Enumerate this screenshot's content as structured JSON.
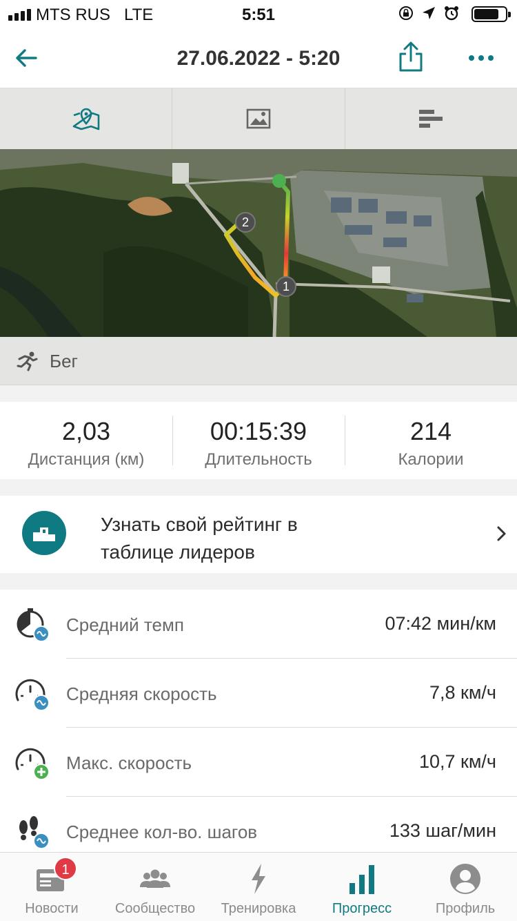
{
  "status_bar": {
    "carrier": "MTS RUS",
    "network": "LTE",
    "time": "5:51",
    "icons": [
      "orientation-lock-icon",
      "location-arrow-icon",
      "alarm-icon",
      "battery-icon"
    ],
    "battery_level": 0.8
  },
  "header": {
    "title": "27.06.2022 - 5:20",
    "back_icon": "back-arrow-icon",
    "share_icon": "share-icon",
    "more_icon": "more-dots-icon"
  },
  "segment_tabs": [
    {
      "name": "map",
      "icon": "map-pin-icon",
      "active": true
    },
    {
      "name": "photos",
      "icon": "image-icon",
      "active": false
    },
    {
      "name": "stats",
      "icon": "bars-icon",
      "active": false
    }
  ],
  "map": {
    "markers": [
      "1",
      "2"
    ]
  },
  "activity": {
    "icon": "running-icon",
    "label": "Бег"
  },
  "stats": [
    {
      "value": "2,03",
      "label": "Дистанция (км)"
    },
    {
      "value": "00:15:39",
      "label": "Длительность"
    },
    {
      "value": "214",
      "label": "Калории"
    }
  ],
  "leaderboard": {
    "line1": "Узнать свой рейтинг в",
    "line2": "таблице лидеров",
    "icon": "podium-icon"
  },
  "metrics": [
    {
      "icon": "stopwatch-avg-icon",
      "name": "Средний темп",
      "value": "07:42 мин/км"
    },
    {
      "icon": "speedometer-avg-icon",
      "name": "Средняя скорость",
      "value": "7,8 км/ч"
    },
    {
      "icon": "speedometer-max-icon",
      "name": "Макс. скорость",
      "value": "10,7 км/ч"
    },
    {
      "icon": "footsteps-avg-icon",
      "name": "Среднее кол-во. шагов",
      "value": "133 шаг/мин"
    }
  ],
  "bottom_nav": [
    {
      "label": "Новости",
      "icon": "news-icon",
      "badge": "1",
      "active": false
    },
    {
      "label": "Сообщество",
      "icon": "community-icon",
      "active": false
    },
    {
      "label": "Тренировка",
      "icon": "lightning-icon",
      "active": false
    },
    {
      "label": "Прогресс",
      "icon": "progress-bars-icon",
      "active": true
    },
    {
      "label": "Профиль",
      "icon": "profile-icon",
      "active": false
    }
  ],
  "colors": {
    "accent": "#0f7a82",
    "badge": "#e03a45",
    "route_start": "#4caf50",
    "route_hot": "#e53935"
  }
}
